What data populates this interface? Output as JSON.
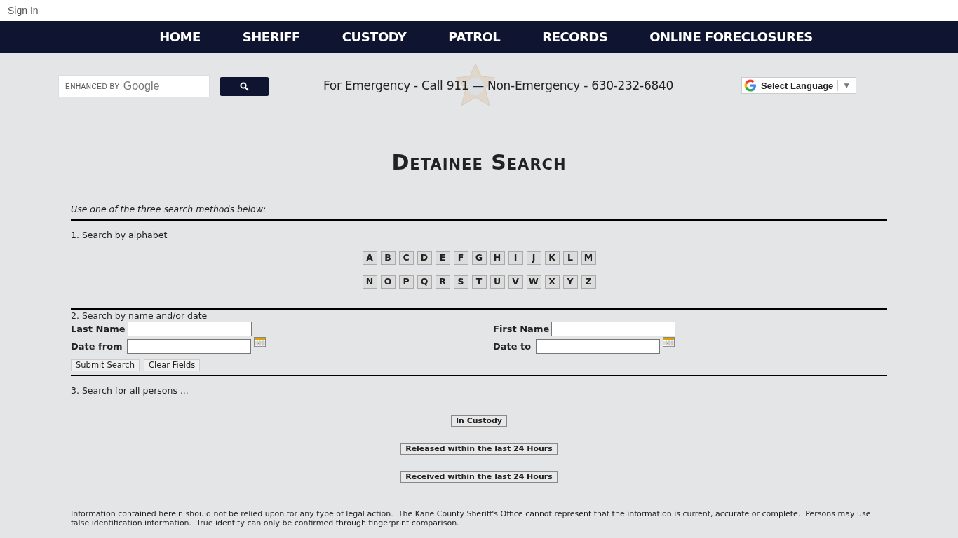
{
  "top_bar": {
    "sign_in": "Sign In"
  },
  "nav": [
    "HOME",
    "SHERIFF",
    "CUSTODY",
    "PATROL",
    "RECORDS",
    "ONLINE FORECLOSURES"
  ],
  "header": {
    "search": {
      "hint_prefix": "ENHANCED BY",
      "hint_brand": "Google"
    },
    "emergency": "For Emergency - Call 911 — Non-Emergency - 630-232-6840",
    "language": {
      "label": "Select Language",
      "arrow": "▼"
    }
  },
  "page_title": "Detainee Search",
  "intro": "Use one of the three search methods below:",
  "alphabet_section": {
    "heading": "1. Search by alphabet",
    "rows": [
      [
        "A",
        "B",
        "C",
        "D",
        "E",
        "F",
        "G",
        "H",
        "I",
        "J",
        "K",
        "L",
        "M"
      ],
      [
        "N",
        "O",
        "P",
        "Q",
        "R",
        "S",
        "T",
        "U",
        "V",
        "W",
        "X",
        "Y",
        "Z"
      ]
    ]
  },
  "name_section": {
    "heading": "2. Search by name and/or date",
    "last_name": "Last Name",
    "first_name": "First Name",
    "date_from": "Date from",
    "date_to": "Date to",
    "buttons": [
      "Submit Search",
      "Clear Fields"
    ]
  },
  "all_section": {
    "heading": "3. Search for all persons ...",
    "buttons": [
      "In Custody",
      "Released within the last 24 Hours",
      "Received within the last 24 Hours"
    ]
  },
  "disclaimer": "Information contained herein should not be relied upon for any type of legal action.  The Kane County Sheriff's Office cannot represent that the information is current, accurate or complete.  Persons may use false identification information.  True identity can only be confirmed through fingerprint comparison."
}
